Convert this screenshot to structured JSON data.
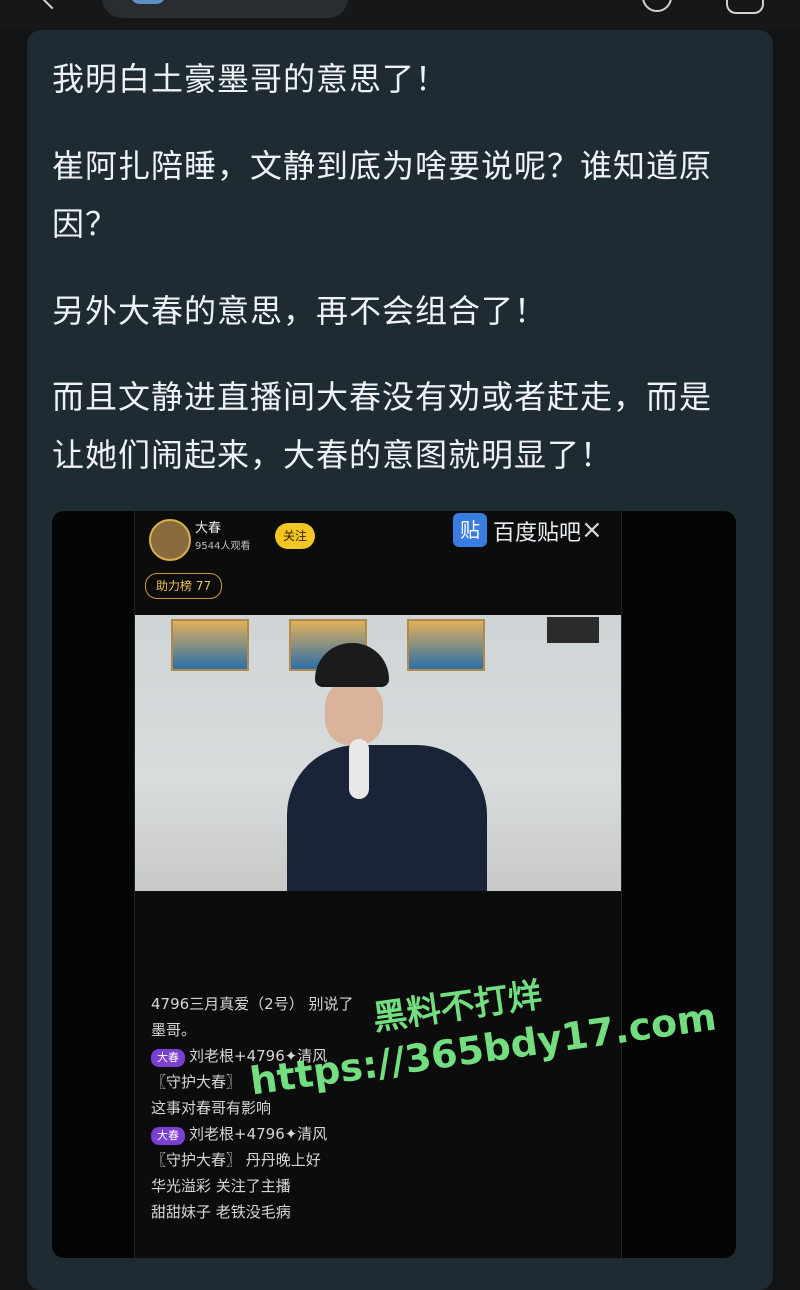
{
  "post": {
    "paragraphs": [
      "我明白土豪墨哥的意思了！",
      "崔阿扎陪睡，文静到底为啥要说呢？谁知道原因？",
      "另外大春的意思，再不会组合了！",
      "而且文静进直播间大春没有劝或者赶走，而是让她们闹起来，大春的意图就明显了！"
    ]
  },
  "stream": {
    "streamer_name": "大春",
    "viewers": "9544人观看",
    "follow_label": "关注",
    "rank_label": "助力榜 77",
    "tieba_mark": "贴",
    "tieba_label": "百度贴吧",
    "close": "×"
  },
  "chat": [
    "4796三月真爱（2号） 别说了",
    "墨哥。",
    "刘老根+4796✦清风",
    "〖守护大春〗",
    "这事对春哥有影响",
    "刘老根+4796✦清风",
    "〖守护大春〗 丹丹晚上好",
    "华光溢彩 关注了主播",
    "甜甜妹子 老铁没毛病"
  ],
  "chat_badge": "大春",
  "watermark": {
    "line1": "黑料不打烊",
    "line2": "https://365bdy17.com"
  }
}
